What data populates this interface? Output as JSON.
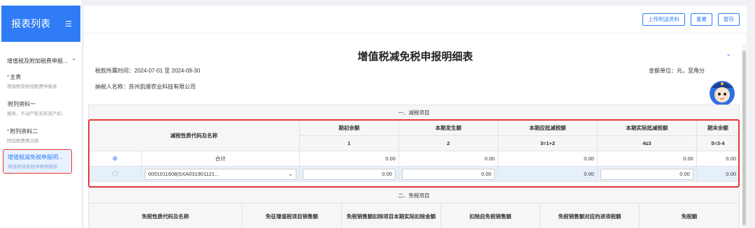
{
  "sidebar": {
    "title": "报表列表",
    "menu_icon": "menu-icon",
    "group": {
      "label": "增值税及附加税费申报...",
      "icon": "chevron-up-icon"
    },
    "items": [
      {
        "req": "*",
        "label": "主表",
        "sub": "增值税及附加税费申报表"
      },
      {
        "req": "",
        "label": "附列资料一",
        "sub": "服务、不动产和无形资产扣..."
      },
      {
        "req": "*",
        "label": "附列资料二",
        "sub": "附加税费情况表"
      },
      {
        "req": "",
        "label": "增值税减免税申报明...",
        "sub": "增值税减免税申报明细表"
      }
    ]
  },
  "toolbar": {
    "upload": "上传附送资料",
    "reset": "重置",
    "save": "暂存"
  },
  "page": {
    "title": "增值税减免税申报明细表",
    "period": "税款所属时间：2024-07-01 至 2024-09-30",
    "taxpayer": "纳税人名称：苏州凯顺农业科技有限公司",
    "unit": "金额单位：元，至角分",
    "mascot_icon": "tax-assistant-mascot-icon"
  },
  "section1": {
    "title": "一、减税项目",
    "name_header": "减税性质代码及名称",
    "headers": [
      "期初余额",
      "本期发生额",
      "本期应抵减税额",
      "本期实际抵减税额",
      "期末余额"
    ],
    "codes": [
      "1",
      "2",
      "3=1+2",
      "4≤3",
      "5=3-4"
    ],
    "total_label": "合计",
    "total_values": [
      "0.00",
      "0.00",
      "0.00",
      "0.00",
      "0.00"
    ],
    "row_code": "0001011608|SXA031901121...",
    "row_values": [
      "0.00",
      "0.00",
      "0.00",
      "0.00",
      "0.00"
    ]
  },
  "section2": {
    "title": "二、免税项目",
    "name_header": "免税性质代码及名称",
    "headers": [
      "免征增值税项目销售额",
      "免税销售额扣除项目本期实际扣除金额",
      "扣除后免税销售额",
      "免税销售额对应的进项税额",
      "免税额"
    ]
  },
  "colors": {
    "accent": "#2f7cf6",
    "highlight_border": "#e53935"
  }
}
